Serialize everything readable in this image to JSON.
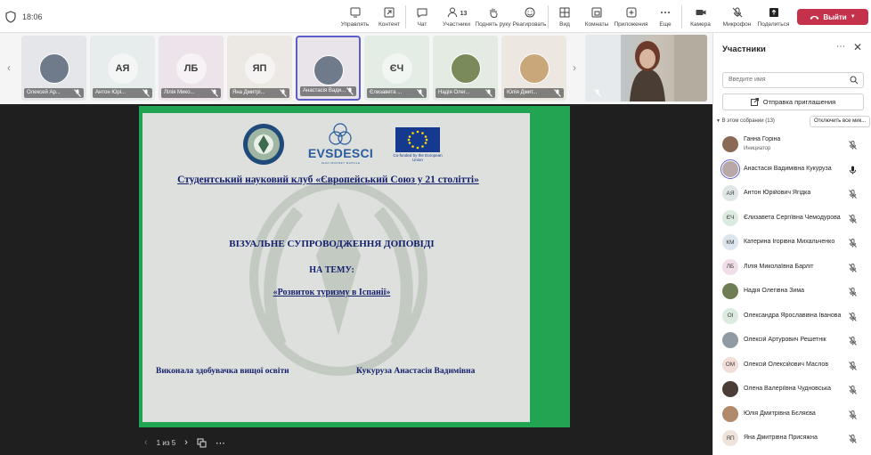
{
  "topbar": {
    "timer": "18:06",
    "tools": [
      {
        "label": "Управлять",
        "icon": "manage-icon"
      },
      {
        "label": "Контент",
        "icon": "share-content-icon"
      },
      {
        "label": "Чат",
        "icon": "chat-icon"
      },
      {
        "label": "Участники",
        "icon": "people-icon",
        "count": "13"
      },
      {
        "label": "Поднять руку",
        "icon": "raise-hand-icon"
      },
      {
        "label": "Реагировать",
        "icon": "react-icon"
      },
      {
        "label": "Вид",
        "icon": "view-icon"
      },
      {
        "label": "Комнаты",
        "icon": "rooms-icon"
      },
      {
        "label": "Приложения",
        "icon": "apps-icon"
      },
      {
        "label": "Еще",
        "icon": "more-icon"
      },
      {
        "label": "Камера",
        "icon": "camera-icon"
      },
      {
        "label": "Микрофон",
        "icon": "mic-off-icon"
      },
      {
        "label": "Поделиться",
        "icon": "share-icon"
      }
    ],
    "leave_label": "Выйти",
    "leave_color": "#c4314b"
  },
  "strip": {
    "tiles": [
      {
        "label": "Олексей Ар...",
        "initials": "",
        "photo": true,
        "bg": "#e4e6ea"
      },
      {
        "label": "Антон Юрі...",
        "initials": "АЯ",
        "photo": false,
        "bg": "#e7ecec"
      },
      {
        "label": "Лілія Мико...",
        "initials": "ЛБ",
        "photo": false,
        "bg": "#ece4ea"
      },
      {
        "label": "Яна Дмитрі...",
        "initials": "ЯП",
        "photo": false,
        "bg": "#ece8e4"
      },
      {
        "label": "Анастасія Вади...",
        "initials": "",
        "photo": true,
        "bg": "#e9e4ea",
        "active": true
      },
      {
        "label": "Єлизавета ...",
        "initials": "ЄЧ",
        "photo": false,
        "bg": "#e4ece6"
      },
      {
        "label": "Надія Олег...",
        "initials": "",
        "photo": true,
        "bg": "#e4ebe2"
      },
      {
        "label": "Юлія Дмит...",
        "initials": "",
        "photo": true,
        "bg": "#ece7e0"
      }
    ]
  },
  "slide": {
    "evs_logo": "EVSDESCI",
    "evs_sub": "JEAN MONNET MODULE",
    "eu_text": "Co-funded by the European Union",
    "club": "Студентський науковий клуб «Європейський Союз у 21 столітті»",
    "title": "ВІЗУАЛЬНЕ СУПРОВОДЖЕННЯ ДОПОВІДІ",
    "theme": "НА ТЕМУ:",
    "topic": "«Розвиток туризму в Іспанії»",
    "author_label": "Виконала здобувачка вищої освіти",
    "author_name": "Кукуруза Анастасія Вадимівна",
    "frame_color": "#22a552"
  },
  "pager": {
    "page": "1 из 5"
  },
  "panel": {
    "title": "Участники",
    "search_placeholder": "Введите имя",
    "invite_label": "Отправка приглашения",
    "section_label": "В этом собрании (13)",
    "mute_all_label": "Отключить все мик...",
    "participants": [
      {
        "name": "Ганна Горіна",
        "role": "Инициатор",
        "initials": "",
        "photo": true,
        "bg": "#8a6a55",
        "mic": "off"
      },
      {
        "name": "Анастасія Вадимівна Кукуруза",
        "role": "",
        "initials": "",
        "photo": true,
        "bg": "#b9a8a8",
        "mic": "on",
        "speaking": true
      },
      {
        "name": "Антон Юрійович Ягідка",
        "role": "",
        "initials": "АЯ",
        "photo": false,
        "bg": "#dfe6e6",
        "mic": "off"
      },
      {
        "name": "Єлизавета Сергіївна Чемодурова",
        "role": "",
        "initials": "ЄЧ",
        "photo": false,
        "bg": "#dcebe0",
        "mic": "off"
      },
      {
        "name": "Катерина Ігорівна Михальченко",
        "role": "",
        "initials": "КМ",
        "photo": false,
        "bg": "#dde6ee",
        "mic": "off"
      },
      {
        "name": "Лілія Миколаївна Барліт",
        "role": "",
        "initials": "ЛБ",
        "photo": false,
        "bg": "#f0dfe8",
        "mic": "off"
      },
      {
        "name": "Надія Олегівна Зима",
        "role": "",
        "initials": "",
        "photo": true,
        "bg": "#6e7d54",
        "mic": "off"
      },
      {
        "name": "Олександра Ярославівна Іванова",
        "role": "",
        "initials": "ОІ",
        "photo": false,
        "bg": "#dcebe0",
        "mic": "off"
      },
      {
        "name": "Олексій Артурович Решетнік",
        "role": "",
        "initials": "",
        "photo": true,
        "bg": "#8f9aa3",
        "mic": "off"
      },
      {
        "name": "Олексій Олексійович Маслов",
        "role": "",
        "initials": "ОМ",
        "photo": false,
        "bg": "#f3ddd8",
        "mic": "off"
      },
      {
        "name": "Олена Валеріївна Чудновська",
        "role": "",
        "initials": "",
        "photo": true,
        "bg": "#4a3d36",
        "mic": "off"
      },
      {
        "name": "Юлія Дмитрівна Бєляєва",
        "role": "",
        "initials": "",
        "photo": true,
        "bg": "#b08a6a",
        "mic": "off"
      },
      {
        "name": "Яна Дмитрівна Присяжна",
        "role": "",
        "initials": "ЯП",
        "photo": false,
        "bg": "#efe4dc",
        "mic": "off"
      }
    ]
  }
}
